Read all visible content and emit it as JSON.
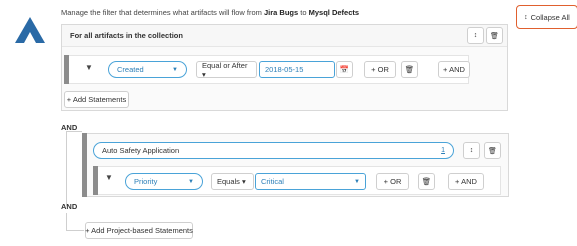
{
  "header": {
    "description_prefix": "Manage the filter that determines what artifacts will flow from ",
    "source": "Jira Bugs",
    "connector": " to ",
    "target": "Mysql Defects",
    "collapse_all": "Collapse All",
    "collapse_icon": "↕"
  },
  "collection_panel": {
    "title": "For all artifacts in the collection",
    "sort_icon": "↕",
    "trash_icon": "🗑",
    "statement": {
      "field": "Created",
      "operator": "Equal or After ▾",
      "value": "2018-05-15",
      "calendar_icon": "📅",
      "or_label": "+ OR",
      "and_label": "+ AND"
    },
    "add_statements": "+ Add Statements"
  },
  "and_label_1": "AND",
  "project_panel": {
    "project": "Auto Safety Application",
    "badge": "1",
    "statement": {
      "field": "Priority",
      "operator": "Equals ▾",
      "value": "Critical",
      "or_label": "+ OR",
      "and_label": "+ AND"
    }
  },
  "and_label_2": "AND",
  "add_project_statements": "+ Add Project-based Statements",
  "colors": {
    "accent": "#4aa3d8",
    "logo": "#2a6aa6",
    "highlight_border": "#e0602e"
  }
}
